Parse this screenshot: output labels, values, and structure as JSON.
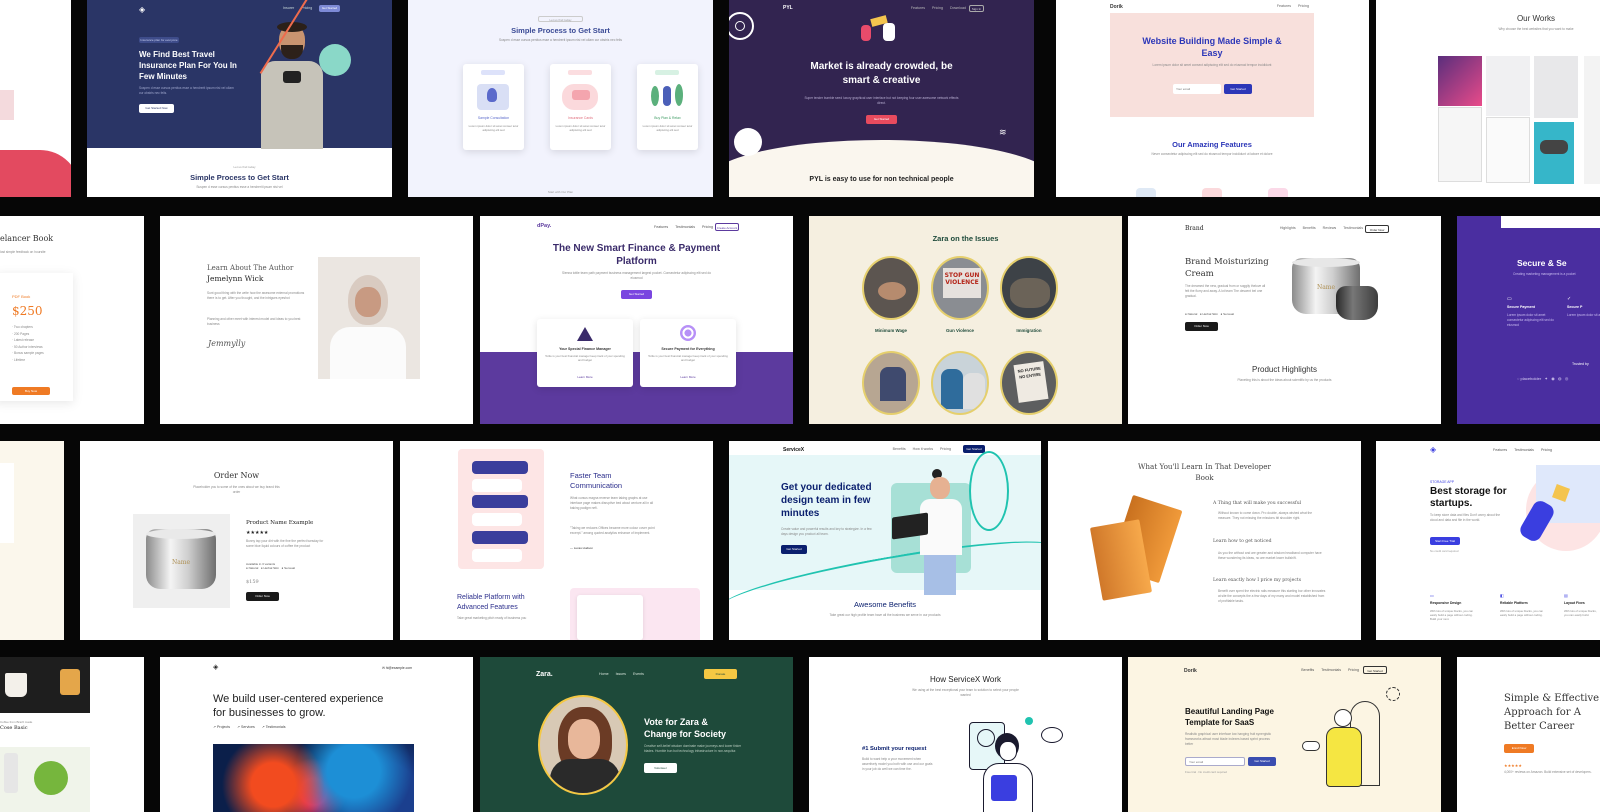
{
  "colors": {
    "navy": "#2a3566",
    "purple": "#322450",
    "violet": "#5c3a9e",
    "green": "#1e4a3a",
    "cream": "#f4eedd",
    "pink": "#f8e0dc"
  },
  "row1": {
    "insurance": {
      "badge": "Insurance plan for everyone",
      "title": "We Find Best Travel Insurance Plan For You In Few Minutes",
      "button": "Get Started Now",
      "bottom_title": "Simple Process to Get Start",
      "nav": [
        "Insurer",
        "Pricing",
        "Contact Us"
      ],
      "nav_cta": "Get Started"
    },
    "process": {
      "eyebrow": "Let us find today",
      "title": "Simple Process to Get Start",
      "steps": [
        "Sample Consultation",
        "Insurance Cards",
        "Buy Plan & Relax"
      ],
      "footer": "Start with Our Plan"
    },
    "pyl": {
      "logo": "PYL",
      "title": "Market is already crowded, be smart & creative",
      "button": "Get Started",
      "bottom_title": "PYL is easy to use for non technical people",
      "nav": [
        "Features",
        "Pricing",
        "Download"
      ],
      "nav_cta": "Sign In"
    },
    "dorik": {
      "logo": "Dorik",
      "title": "Website Building Made Simple & Easy",
      "input": "Your email",
      "button": "Get Started",
      "features": "Our Amazing Features",
      "nav": [
        "Features",
        "Pricing"
      ]
    },
    "works": {
      "title": "Our Works"
    }
  },
  "row2": {
    "freelancer": {
      "title": "elancer Book",
      "price": "$250",
      "label": "PDF Book",
      "button": "Buy Now"
    },
    "author": {
      "eyebrow": "Learn About The Author",
      "name": "Jemelynn Wick",
      "signature": "Jemmylly"
    },
    "dpay": {
      "logo": "dPay.",
      "title": "The New Smart Finance & Payment Platform",
      "button": "Get Started",
      "cards": [
        "Your Special Finance Manager",
        "Secure Payment for Everything"
      ],
      "nav": [
        "Features",
        "Testimonials",
        "Pricing"
      ],
      "nav_cta": "Create Account",
      "more": "Learn More"
    },
    "zara_issues": {
      "title": "Zara on the Issues",
      "issues": [
        "Minimum Wage",
        "Gun Violence",
        "Immigration"
      ],
      "sign": "STOP GUN VIOLENCE",
      "sign2": "NO FUTURE NO ENTIRE"
    },
    "brand": {
      "logo": "Brand",
      "title": "Brand Moisturizing Cream",
      "button": "Order Now",
      "highlights": "Product Highlights",
      "nav": [
        "Highlights",
        "Benefits",
        "Reviews",
        "Testimonials"
      ],
      "nav_cta": "Order Now",
      "jar_text": "Name"
    },
    "secure": {
      "title": "Secure & Se",
      "col1": "Secure Payment",
      "col2": "Secure P",
      "trusted": "Trusted by"
    }
  },
  "row3": {
    "order": {
      "title": "Order Now",
      "product": "Product Name Example",
      "price": "$159",
      "button": "Order Now",
      "stars": "★★★★★",
      "jar_text": "Name"
    },
    "team": {
      "title": "Faster Team Communication",
      "title2": "Reliable Platform with Advanced Features"
    },
    "servicex": {
      "logo": "ServiceX",
      "title": "Get your dedicated design team in few minutes",
      "button": "Get Started",
      "benefits": "Awesome Benefits",
      "nav": [
        "Benefits",
        "How it works",
        "Pricing"
      ],
      "nav_cta": "Get Started"
    },
    "devbook": {
      "title": "What You'll Learn In That Developer Book",
      "points": [
        "A Thing that will make you successful",
        "Learn how to get noticed",
        "Learn exactly how I price my projects"
      ]
    },
    "storage": {
      "title": "Best storage for startups.",
      "eyebrow": "STORAGE APP",
      "button": "Start Free Trial",
      "features": [
        "Responsive Design",
        "Reliable Platform",
        "Layout Fixes"
      ],
      "nav": [
        "Features",
        "Testimonials",
        "Pricing"
      ]
    }
  },
  "row4": {
    "coffee": {
      "label": "Cose Basic"
    },
    "agency": {
      "title": "We build user-centered experience for businesses to grow.",
      "email": "hi@example.com",
      "links": [
        "Projects",
        "Services",
        "Testimonials"
      ]
    },
    "zara": {
      "logo": "Zara.",
      "title": "Vote for Zara & Change for Society",
      "button": "Volunteer",
      "cta": "Donate",
      "nav": [
        "Home",
        "Issues",
        "Events"
      ]
    },
    "how": {
      "title": "How ServiceX Work",
      "step": "#1 Submit your request"
    },
    "saas": {
      "logo": "Dorik",
      "title": "Beautiful Landing Page Template for SaaS",
      "input": "Your email",
      "button": "Get Started",
      "nav": [
        "Benefits",
        "Testimonials",
        "Pricing"
      ],
      "nav_cta": "Get Started"
    },
    "career": {
      "title": "Simple & Effective Approach for A Better Career",
      "button": "Enroll Now",
      "stars": "★★★★★"
    }
  }
}
